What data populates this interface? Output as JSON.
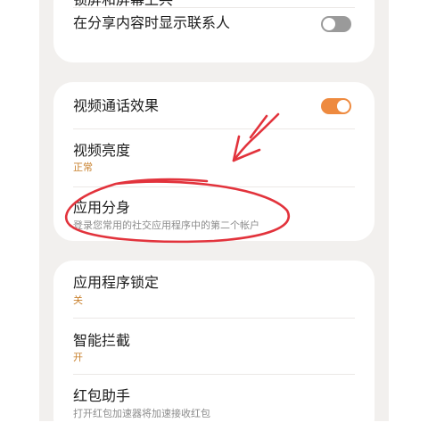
{
  "section1": {
    "partial_item": "锁屏和屏幕上共",
    "show_contacts_when_sharing": {
      "title": "在分享内容时显示联系人",
      "toggle_state": "off"
    }
  },
  "section2": {
    "video_call_effects": {
      "title": "视频通话效果",
      "toggle_state": "on"
    },
    "video_brightness": {
      "title": "视频亮度",
      "value": "正常"
    },
    "dual_apps": {
      "title": "应用分身",
      "description": "登录您常用的社交应用程序中的第二个帐户"
    }
  },
  "section3": {
    "app_lock": {
      "title": "应用程序锁定",
      "value": "关"
    },
    "smart_block": {
      "title": "智能拦截",
      "value": "开"
    },
    "red_envelope": {
      "title": "红包助手",
      "description": "打开红包加速器将加速接收红包"
    }
  },
  "colors": {
    "accent": "#c9822f",
    "toggle_on": "#ee8a3f",
    "toggle_off": "#9a9a9a",
    "annotation": "#e2333c",
    "background": "#f2f0ee"
  }
}
